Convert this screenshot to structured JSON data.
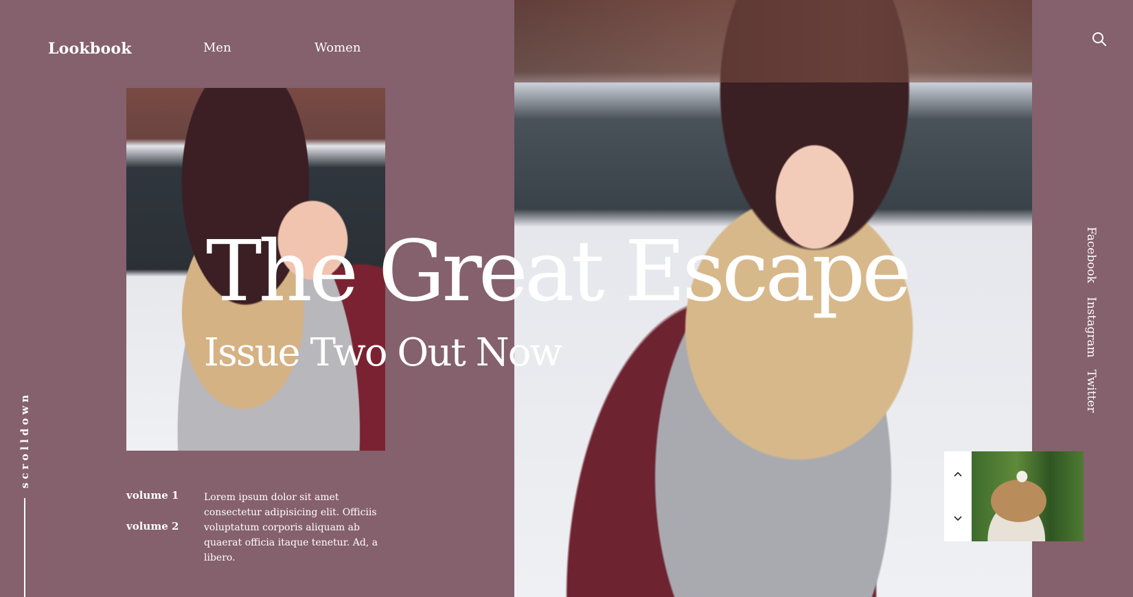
{
  "header": {
    "brand": "Lookbook",
    "nav": [
      "Men",
      "Women"
    ]
  },
  "hero": {
    "title": "The Great Escape",
    "subtitle": "Issue Two Out Now"
  },
  "volumes": [
    "volume 1",
    "volume 2"
  ],
  "description": "Lorem ipsum dolor sit amet consectetur adipisicing elit. Officiis voluptatum corporis aliquam ab quaerat officia itaque tenetur. Ad, a libero.",
  "scroll": {
    "label": "scrolldown"
  },
  "social": [
    "Facebook",
    "Instagram",
    "Twitter"
  ],
  "icons": {
    "search": "search-icon",
    "up": "chevron-up-icon",
    "down": "chevron-down-icon"
  },
  "colors": {
    "background": "#85606d",
    "text": "#ffffff"
  }
}
